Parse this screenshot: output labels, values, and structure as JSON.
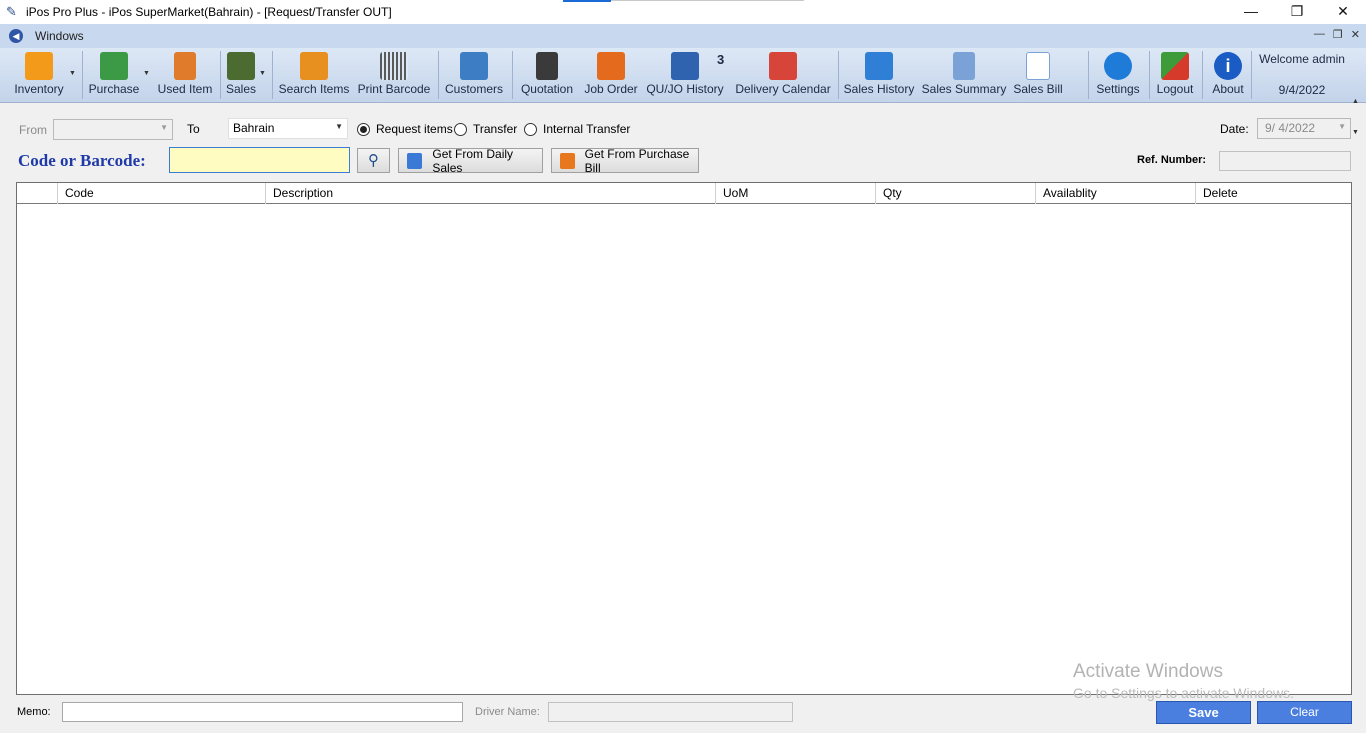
{
  "window": {
    "title": "iPos Pro Plus - iPos SuperMarket(Bahrain) - [Request/Transfer OUT]",
    "minimize": "—",
    "restore": "❐",
    "close": "✕"
  },
  "mdi": {
    "label": "Windows",
    "controls": [
      "—",
      "❐",
      "✕"
    ]
  },
  "toolbar": {
    "items": [
      {
        "label": "Inventory",
        "icon": "inventory-box-icon",
        "color": "#f39a1b"
      },
      {
        "label": "Purchase",
        "icon": "truck-icon",
        "color": "#3c9a46"
      },
      {
        "label": "Used Item",
        "icon": "phone-icon",
        "color": "#e07b2c"
      },
      {
        "label": "Sales",
        "icon": "money-icon",
        "color": "#4b6b30"
      },
      {
        "label": "Search Items",
        "icon": "search-items-icon",
        "color": "#e8901f"
      },
      {
        "label": "Print Barcode",
        "icon": "barcode-icon",
        "color": "#5a5a5a"
      },
      {
        "label": "Customers",
        "icon": "customers-card-icon",
        "color": "#3c7dc4"
      },
      {
        "label": "Quotation",
        "icon": "calculator-icon",
        "color": "#3a3a3a"
      },
      {
        "label": "Job Order",
        "icon": "job-order-icon",
        "color": "#e46b1e"
      },
      {
        "label": "QU/JO History",
        "icon": "history-search-icon",
        "color": "#2f63b0"
      },
      {
        "label": "Delivery Calendar",
        "icon": "calendar-icon",
        "color": "#d6443a"
      },
      {
        "label": "Sales History",
        "icon": "sales-history-icon",
        "color": "#2f7fd6"
      },
      {
        "label": "Sales Summary",
        "icon": "sales-summary-icon",
        "color": "#7aa2d6"
      },
      {
        "label": "Sales Bill",
        "icon": "sales-bill-icon",
        "color": "#b9cce6"
      },
      {
        "label": "Settings",
        "icon": "settings-gear-icon",
        "color": "#1e7bd8"
      },
      {
        "label": "Logout",
        "icon": "logout-user-icon",
        "color": "#d63a2a"
      },
      {
        "label": "About",
        "icon": "info-icon",
        "color": "#1a5bc4"
      }
    ],
    "history_badge": "3",
    "welcome": "Welcome admin",
    "date": "9/4/2022"
  },
  "form": {
    "from_label": "From",
    "from_value": "",
    "to_label": "To",
    "to_value": "Bahrain",
    "radio_request": "Request items",
    "radio_transfer": "Transfer",
    "radio_internal": "Internal Transfer",
    "date_label": "Date:",
    "date_value": "9/  4/2022",
    "code_label": "Code or Barcode:",
    "code_value": "",
    "btn_daily_sales": "Get From Daily Sales",
    "btn_purchase_bill": "Get From Purchase Bill",
    "ref_label": "Ref. Number:",
    "ref_value": ""
  },
  "grid": {
    "columns": [
      "",
      "Code",
      "Description",
      "UoM",
      "Qty",
      "Availablity",
      "Delete"
    ]
  },
  "watermark": {
    "line1": "Activate Windows",
    "line2": "Go to Settings to activate Windows."
  },
  "footer": {
    "memo_label": "Memo:",
    "memo_value": "",
    "driver_label": "Driver Name:",
    "driver_value": "",
    "save": "Save",
    "clear": "Clear"
  }
}
